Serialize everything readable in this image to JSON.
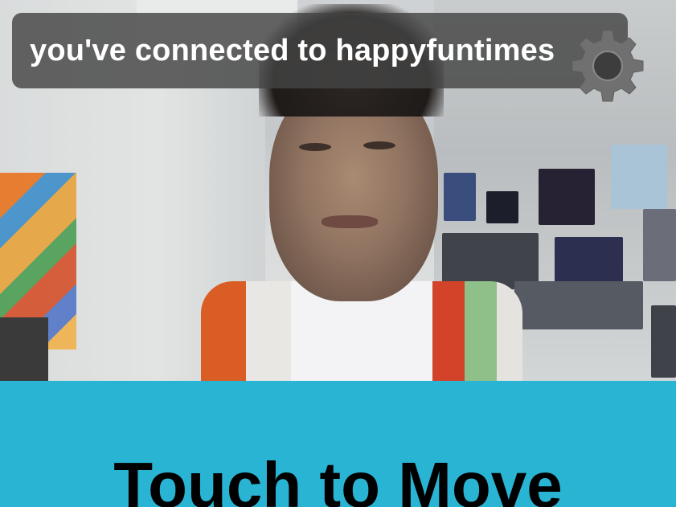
{
  "status_banner": {
    "text": "you've connected to happyfuntimes"
  },
  "settings": {
    "icon": "gear-icon"
  },
  "touch_area": {
    "label": "Touch to Move",
    "background_color": "#2ab4d4"
  },
  "colors": {
    "banner_background": "#444444",
    "banner_text": "#ffffff",
    "gear": "#6f6f6f",
    "touch_text": "#000000"
  }
}
